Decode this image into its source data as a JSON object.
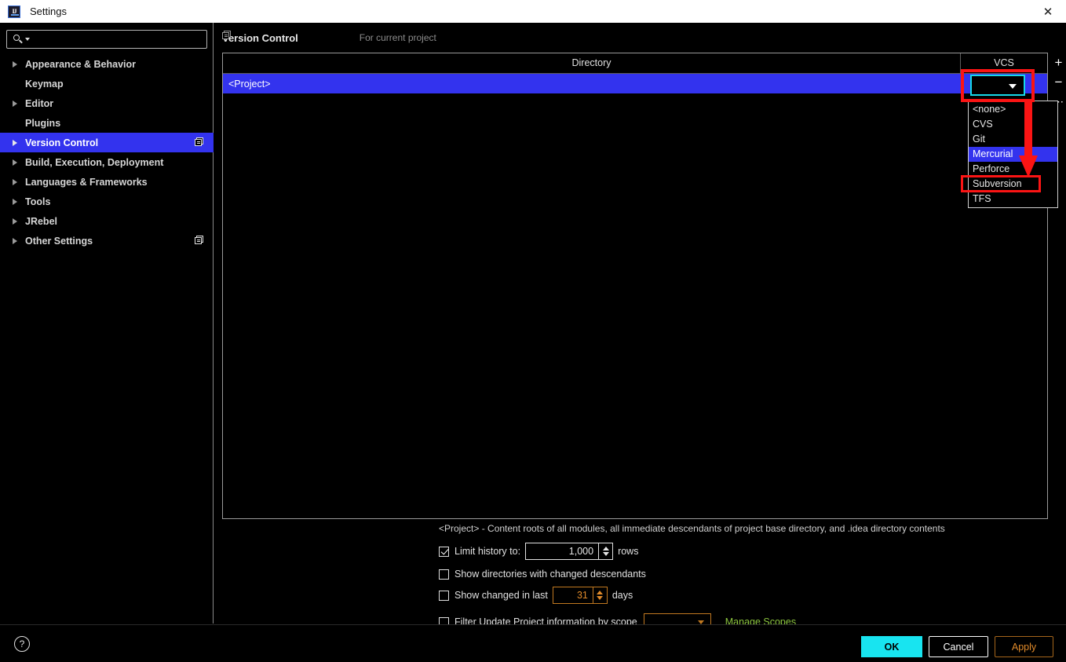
{
  "window": {
    "title": "Settings",
    "app_icon": "intellij-idea-icon",
    "close_icon": "close-icon"
  },
  "search": {
    "value": "",
    "placeholder": "",
    "icon": "search-icon"
  },
  "sidebar": {
    "items": [
      {
        "label": "Appearance & Behavior",
        "expandable": true,
        "selected": false,
        "scope_icon": false
      },
      {
        "label": "Keymap",
        "expandable": false,
        "selected": false,
        "scope_icon": false
      },
      {
        "label": "Editor",
        "expandable": true,
        "selected": false,
        "scope_icon": false
      },
      {
        "label": "Plugins",
        "expandable": false,
        "selected": false,
        "scope_icon": false
      },
      {
        "label": "Version Control",
        "expandable": true,
        "selected": true,
        "scope_icon": true
      },
      {
        "label": "Build, Execution, Deployment",
        "expandable": true,
        "selected": false,
        "scope_icon": false
      },
      {
        "label": "Languages & Frameworks",
        "expandable": true,
        "selected": false,
        "scope_icon": false
      },
      {
        "label": "Tools",
        "expandable": true,
        "selected": false,
        "scope_icon": false
      },
      {
        "label": "JRebel",
        "expandable": true,
        "selected": false,
        "scope_icon": false
      },
      {
        "label": "Other Settings",
        "expandable": true,
        "selected": false,
        "scope_icon": true
      }
    ]
  },
  "content": {
    "title": "Version Control",
    "scope_label": "For current project",
    "scope_icon": "project-scope-icon",
    "table": {
      "columns": [
        "Directory",
        "VCS"
      ],
      "rows": [
        {
          "directory": "<Project>",
          "vcs": ""
        }
      ]
    },
    "toolbar": {
      "add_label": "+",
      "remove_label": "−",
      "more_label": "⋯"
    },
    "vcs_combo": {
      "value": "",
      "arrow_icon": "chevron-down-icon",
      "open": true,
      "options": [
        {
          "label": "<none>",
          "highlighted": false
        },
        {
          "label": "CVS",
          "highlighted": false
        },
        {
          "label": "Git",
          "highlighted": false
        },
        {
          "label": "Mercurial",
          "highlighted": true
        },
        {
          "label": "Perforce",
          "highlighted": false
        },
        {
          "label": "Subversion",
          "highlighted": false
        },
        {
          "label": "TFS",
          "highlighted": false
        }
      ]
    },
    "description": "<Project> - Content roots of all modules, all immediate descendants of project base directory, and .idea directory contents",
    "options": {
      "limit_history": {
        "label": "Limit history to:",
        "checked": true,
        "value": "1,000",
        "suffix": "rows"
      },
      "show_directories": {
        "label": "Show directories with changed descendants",
        "checked": false
      },
      "show_changed": {
        "label": "Show changed in last",
        "checked": false,
        "value": "31",
        "suffix": "days"
      },
      "filter_scope": {
        "label": "Filter Update Project information by scope",
        "checked": false,
        "scope_value": "",
        "manage_link": "Manage Scopes"
      }
    }
  },
  "footer": {
    "help_label": "?",
    "ok_label": "OK",
    "cancel_label": "Cancel",
    "apply_label": "Apply"
  },
  "annotations": {
    "highlight_color": "#fb1414",
    "focus_color": "#15d8e8",
    "boxes": [
      "vcs-combo-highlight",
      "subversion-option-highlight"
    ],
    "arrow": "red-down-arrow"
  }
}
